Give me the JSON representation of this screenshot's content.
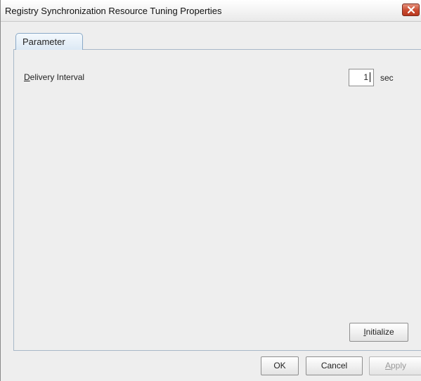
{
  "window": {
    "title": "Registry Synchronization Resource Tuning Properties"
  },
  "tabs": [
    {
      "label": "Parameter",
      "selected": true
    }
  ],
  "parameter": {
    "delivery_interval": {
      "label_mnemonic": "D",
      "label_rest": "elivery Interval",
      "value": "1",
      "unit": "sec"
    }
  },
  "buttons": {
    "initialize": {
      "mnemonic": "I",
      "rest": "nitialize"
    },
    "ok": "OK",
    "cancel": "Cancel",
    "apply": {
      "mnemonic": "A",
      "rest": "pply",
      "enabled": false
    }
  },
  "icons": {
    "close": "close-icon"
  },
  "colors": {
    "close_button": "#c94a2f",
    "tab_border": "#8aa9c7"
  }
}
